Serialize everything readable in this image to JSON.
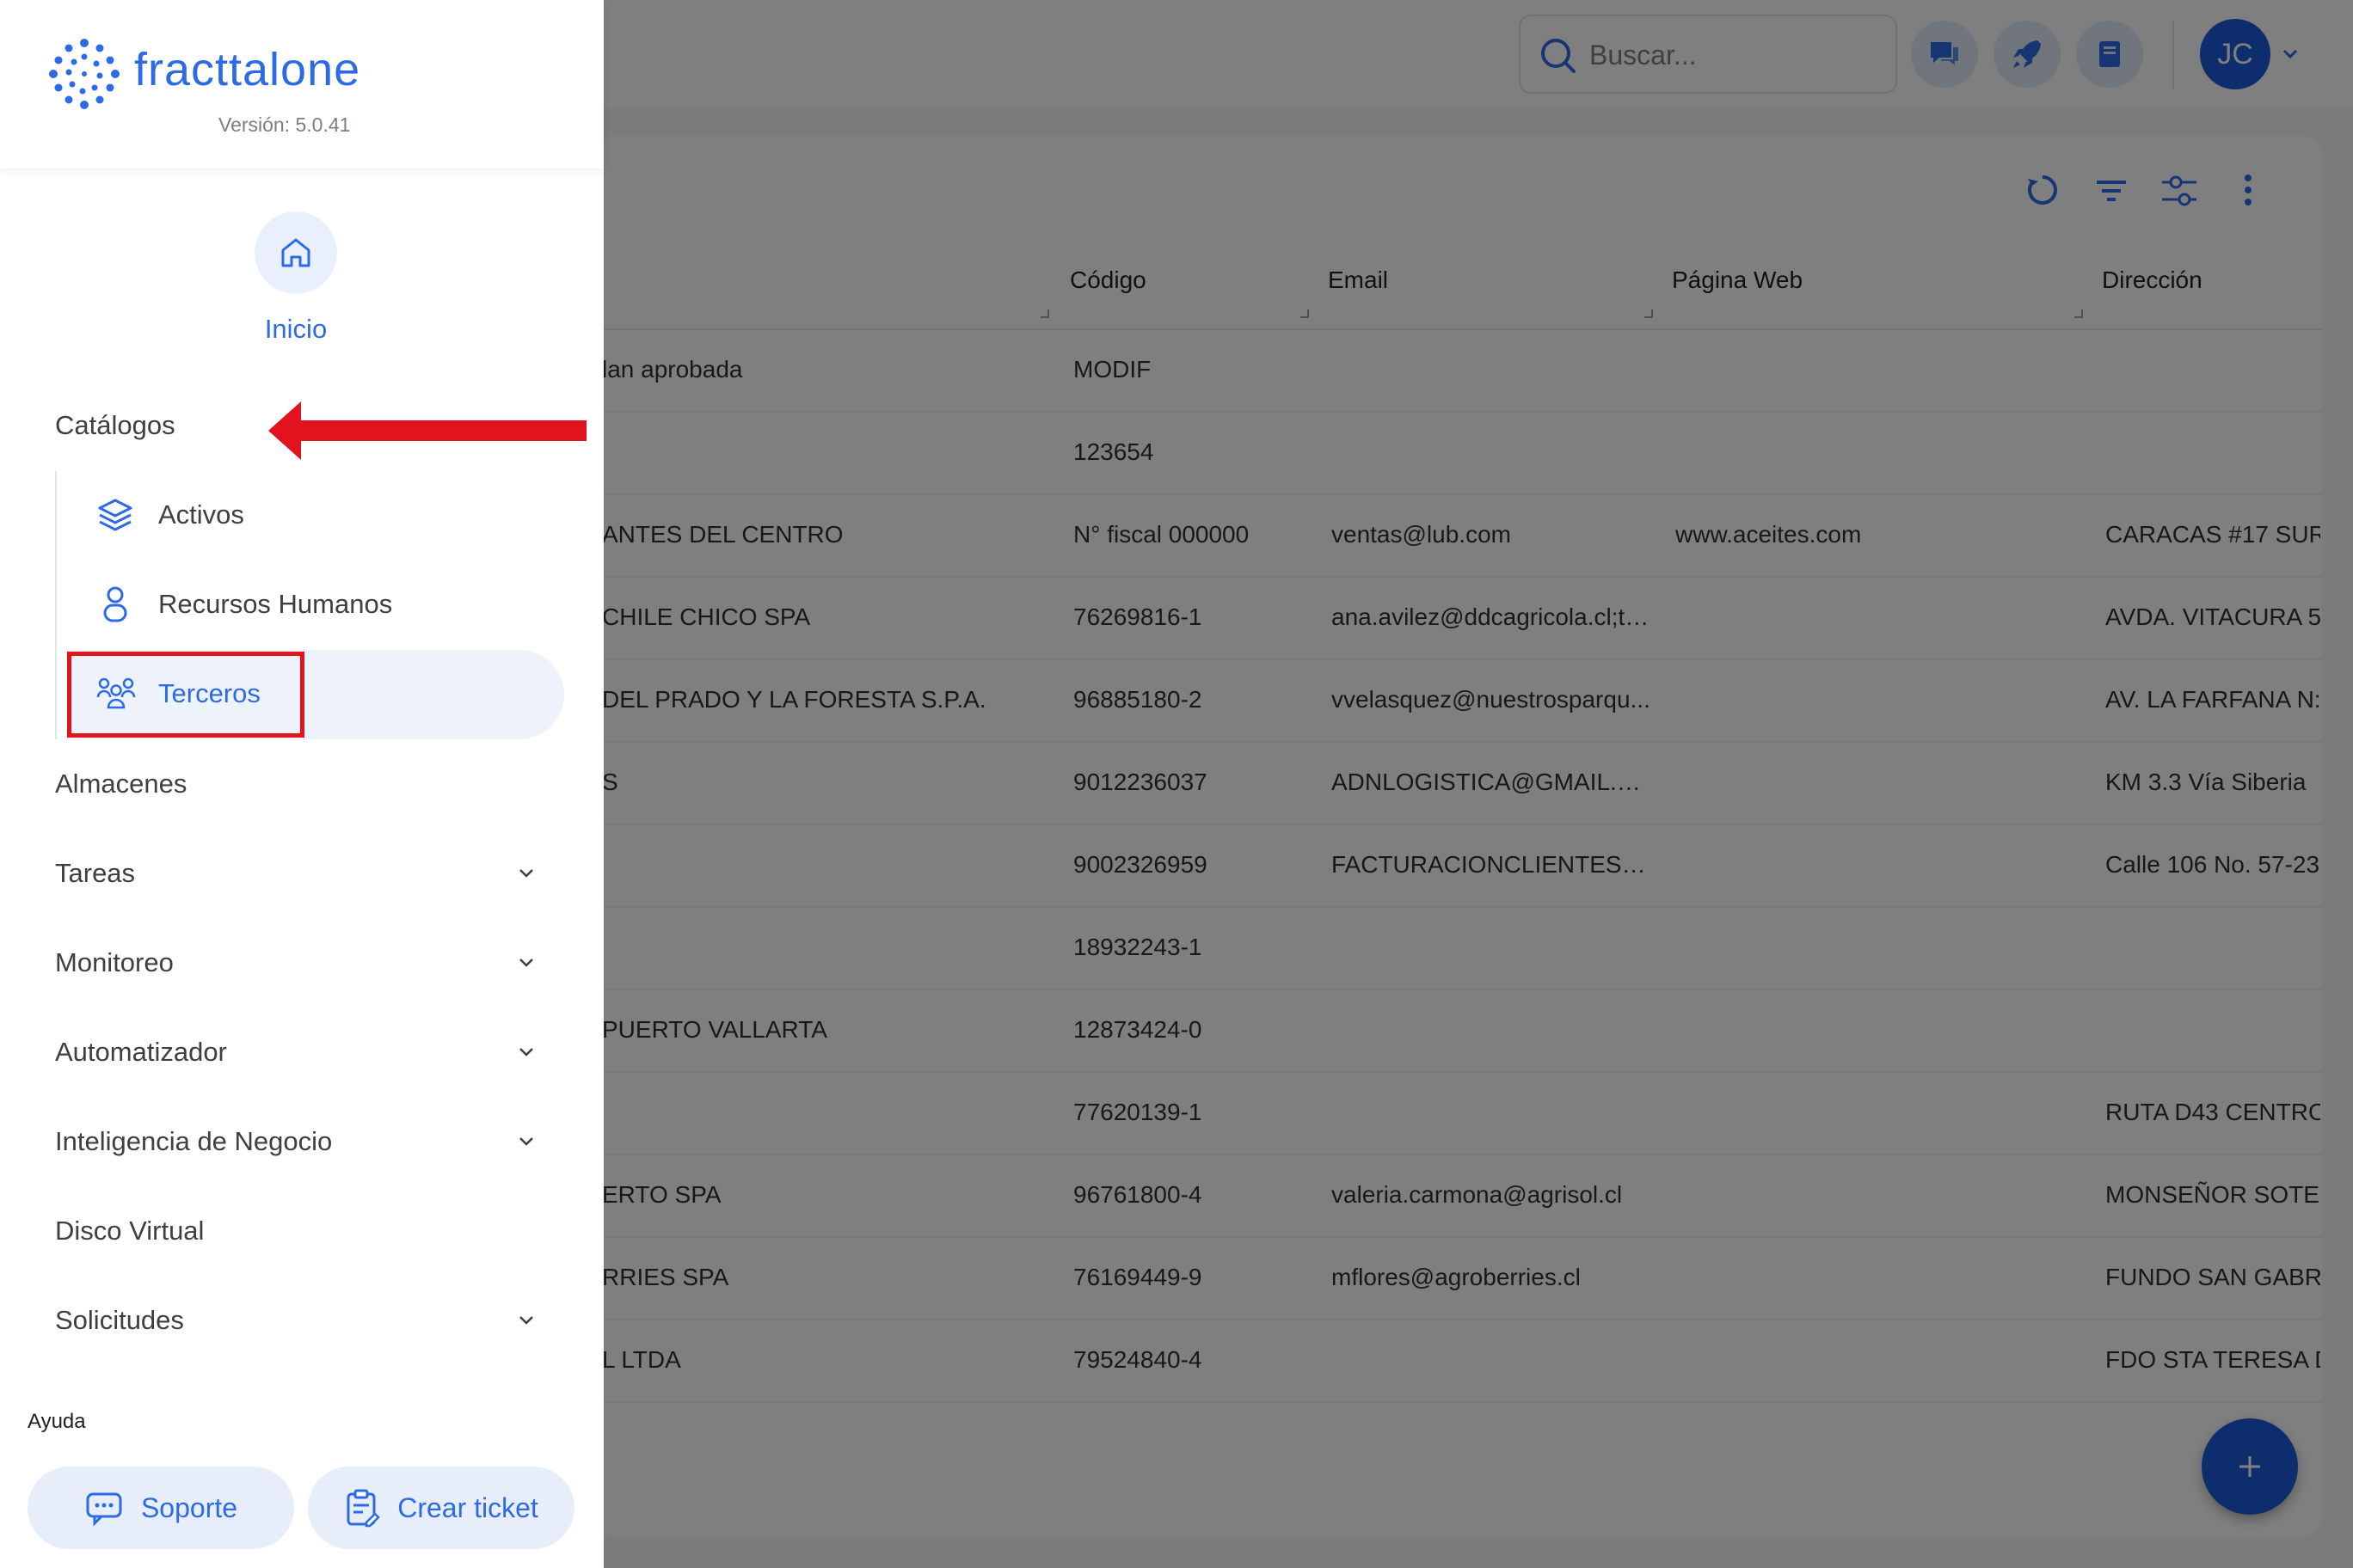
{
  "sidebar": {
    "logo_text": "fracttalone",
    "version": "Versión: 5.0.41",
    "home_label": "Inicio",
    "nav": {
      "catalogos": "Catálogos",
      "activos": "Activos",
      "recursos_humanos": "Recursos Humanos",
      "terceros": "Terceros",
      "almacenes": "Almacenes",
      "tareas": "Tareas",
      "monitoreo": "Monitoreo",
      "automatizador": "Automatizador",
      "inteligencia": "Inteligencia de Negocio",
      "disco": "Disco Virtual",
      "solicitudes": "Solicitudes"
    },
    "help": {
      "title": "Ayuda",
      "support": "Soporte",
      "ticket": "Crear ticket"
    }
  },
  "topbar": {
    "search_placeholder": "Buscar...",
    "avatar_initials": "JC"
  },
  "table": {
    "headers": {
      "code": "Código",
      "email": "Email",
      "web": "Página Web",
      "address": "Dirección"
    },
    "rows": [
      {
        "name": "lan aprobada",
        "code": "MODIF",
        "email": "",
        "web": "",
        "address": ""
      },
      {
        "name": "",
        "code": "123654",
        "email": "",
        "web": "",
        "address": ""
      },
      {
        "name": "ANTES DEL CENTRO",
        "code": "N° fiscal 000000",
        "email": "ventas@lub.com",
        "web": "www.aceites.com",
        "address": "CARACAS #17 SUR"
      },
      {
        "name": "CHILE CHICO SPA",
        "code": "76269816-1",
        "email": "ana.avilez@ddcagricola.cl;ta...",
        "web": "",
        "address": "AVDA. VITACURA 5"
      },
      {
        "name": "DEL PRADO Y LA FORESTA S.P.A.",
        "code": "96885180-2",
        "email": "vvelasquez@nuestrosparqu...",
        "web": "",
        "address": "AV. LA FARFANA N:"
      },
      {
        "name": "S",
        "code": "9012236037",
        "email": "ADNLOGISTICA@GMAIL.COM",
        "web": "",
        "address": "KM 3.3 Vía Siberia"
      },
      {
        "name": "",
        "code": "9002326959",
        "email": "FACTURACIONCLIENTES@A...",
        "web": "",
        "address": "Calle 106 No. 57-23"
      },
      {
        "name": "",
        "code": "18932243-1",
        "email": "",
        "web": "",
        "address": ""
      },
      {
        "name": "PUERTO VALLARTA",
        "code": "12873424-0",
        "email": "",
        "web": "",
        "address": ""
      },
      {
        "name": "",
        "code": "77620139-1",
        "email": "",
        "web": "",
        "address": "RUTA D43 CENTRO"
      },
      {
        "name": "ERTO SPA",
        "code": "96761800-4",
        "email": "valeria.carmona@agrisol.cl",
        "web": "",
        "address": "MONSEÑOR SOTER"
      },
      {
        "name": "RRIES SPA",
        "code": "76169449-9",
        "email": "mflores@agroberries.cl",
        "web": "",
        "address": "FUNDO SAN GABRI"
      },
      {
        "name": "L LTDA",
        "code": "79524840-4",
        "email": "",
        "web": "",
        "address": "FDO STA TERESA D"
      }
    ]
  },
  "colors": {
    "brand": "#2c6be5",
    "fab": "#1d5ad8",
    "highlight_red": "#e3121f"
  },
  "icons": [
    "search-icon",
    "chat-icon",
    "rocket-icon",
    "book-icon",
    "chevron-down-icon",
    "refresh-icon",
    "filter-icon",
    "sliders-icon",
    "more-vertical-icon",
    "plus-icon",
    "home-icon",
    "layers-icon",
    "person-icon",
    "group-icon",
    "support-chat-icon",
    "clipboard-icon",
    "arrow-left-icon"
  ]
}
